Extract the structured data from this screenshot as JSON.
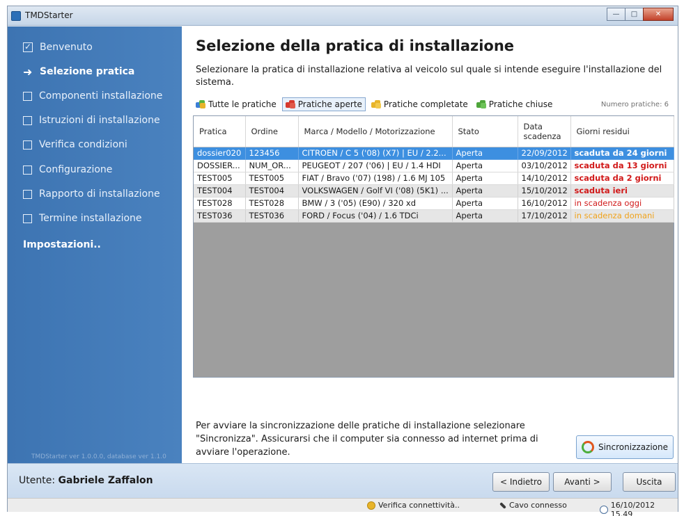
{
  "window": {
    "title": "TMDStarter"
  },
  "sidebar": {
    "steps": [
      {
        "label": "Benvenuto",
        "state": "done"
      },
      {
        "label": "Selezione pratica",
        "state": "current"
      },
      {
        "label": "Componenti installazione",
        "state": "todo"
      },
      {
        "label": "Istruzioni di installazione",
        "state": "todo"
      },
      {
        "label": "Verifica condizioni",
        "state": "todo"
      },
      {
        "label": "Configurazione",
        "state": "todo"
      },
      {
        "label": "Rapporto di installazione",
        "state": "todo"
      },
      {
        "label": "Termine installazione",
        "state": "todo"
      }
    ],
    "settings_label": "Impostazioni..",
    "version": "TMDStarter ver 1.0.0.0, database ver 1.1.0"
  },
  "main": {
    "title": "Selezione della pratica di installazione",
    "description": "Selezionare la pratica di installazione relativa al veicolo sul quale si intende eseguire l'installazione del sistema.",
    "filters": [
      {
        "label": "Tutte le pratiche",
        "icon": "all-folders-icon"
      },
      {
        "label": "Pratiche aperte",
        "icon": "open-folders-icon"
      },
      {
        "label": "Pratiche completate",
        "icon": "completed-folders-icon"
      },
      {
        "label": "Pratiche chiuse",
        "icon": "closed-folders-icon"
      }
    ],
    "count_label": "Numero pratiche: 6",
    "table": {
      "headers": [
        "Pratica",
        "Ordine",
        "Marca / Modello / Motorizzazione",
        "Stato",
        "Data scadenza",
        "Giorni residui"
      ],
      "rows": [
        [
          "dossier020",
          "123456",
          "CITROEN / C 5 ('08) (X7) | EU / 2.2...",
          "Aperta",
          "22/09/2012",
          "scaduta da 24 giorni"
        ],
        [
          "DOSSIER...",
          "NUM_OR...",
          "PEUGEOT / 207 ('06) | EU / 1.4 HDI",
          "Aperta",
          "03/10/2012",
          "scaduta da 13 giorni"
        ],
        [
          "TEST005",
          "TEST005",
          "FIAT / Bravo ('07) (198) / 1.6 MJ 105",
          "Aperta",
          "14/10/2012",
          "scaduta da 2 giorni"
        ],
        [
          "TEST004",
          "TEST004",
          "VOLKSWAGEN / Golf VI ('08) (5K1) ...",
          "Aperta",
          "15/10/2012",
          "scaduta ieri"
        ],
        [
          "TEST028",
          "TEST028",
          "BMW / 3 ('05) (E90) / 320 xd",
          "Aperta",
          "16/10/2012",
          "in scadenza oggi"
        ],
        [
          "TEST036",
          "TEST036",
          "FORD / Focus ('04) / 1.6 TDCi",
          "Aperta",
          "17/10/2012",
          "in scadenza domani"
        ]
      ]
    },
    "info_text": "Per avviare la sincronizzazione delle pratiche di installazione selezionare \"Sincronizza\". Assicurarsi che il computer sia connesso ad internet prima di avviare l'operazione.",
    "sync_label": "Sincronizzazione"
  },
  "footer": {
    "user_prefix": "Utente:",
    "user_name": "Gabriele Zaffalon",
    "back_label": "< Indietro",
    "next_label": "Avanti >",
    "exit_label": "Uscita"
  },
  "statusbar": {
    "connectivity": "Verifica connettività..",
    "cable": "Cavo connesso",
    "datetime": "16/10/2012 15.49"
  },
  "colors": {
    "sidebar": "#3d74b2",
    "selected_row": "#3d8fe0",
    "expired": "#d11a1a",
    "due_tomorrow": "#f0a21a"
  }
}
